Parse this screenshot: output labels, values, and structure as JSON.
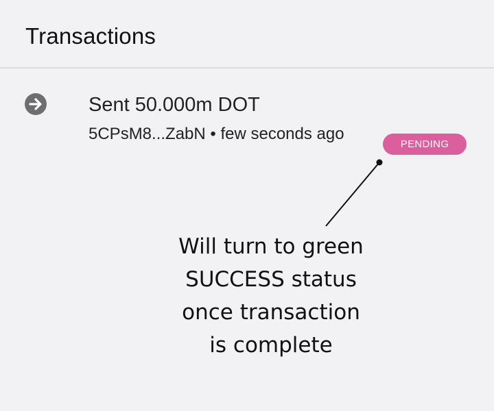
{
  "header": {
    "title": "Transactions"
  },
  "transaction": {
    "icon": "arrow-right-circle-icon",
    "title": "Sent 50.000m DOT",
    "subtitle": "5CPsM8...ZabN • few seconds ago",
    "status": "PENDING",
    "status_color": "#db5e9d"
  },
  "annotation": {
    "lines": [
      "Will turn to green",
      "SUCCESS status",
      "once transaction",
      "is complete"
    ]
  },
  "colors": {
    "background": "#f2f2f4",
    "divider": "#dcdcdf",
    "icon": "#6e6e70"
  }
}
